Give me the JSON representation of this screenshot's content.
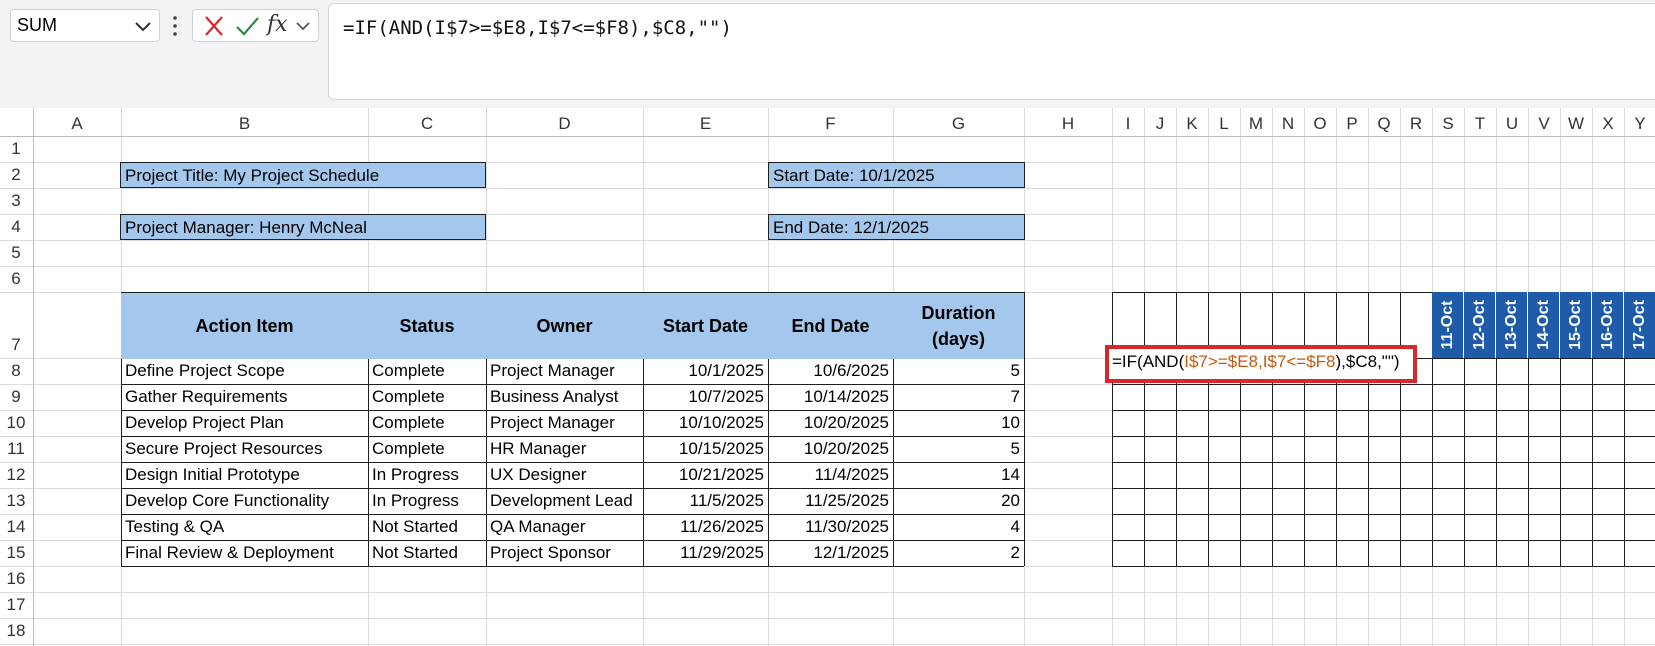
{
  "formula_bar": {
    "name_box": "SUM",
    "formula": "=IF(AND(I$7>=$E8,I$7<=$F8),$C8,\"\")",
    "icons": [
      "cancel-x-icon",
      "enter-check-icon",
      "insert-function-icon"
    ]
  },
  "columns": [
    "A",
    "B",
    "C",
    "D",
    "E",
    "F",
    "G",
    "H",
    "I",
    "J",
    "K",
    "L",
    "M",
    "N",
    "O",
    "P",
    "Q",
    "R",
    "S",
    "T",
    "U",
    "V",
    "W",
    "X",
    "Y"
  ],
  "rows": [
    "1",
    "2",
    "3",
    "4",
    "5",
    "6",
    "7",
    "8",
    "9",
    "10",
    "11",
    "12",
    "13",
    "14",
    "15",
    "16",
    "17",
    "18"
  ],
  "info": {
    "title": "Project Title: My Project Schedule",
    "manager": "Project Manager: Henry McNeal",
    "start": "Start Date: 10/1/2025",
    "end": "End Date: 12/1/2025"
  },
  "table": {
    "headers": [
      "Action Item",
      "Status",
      "Owner",
      "Start Date",
      "End Date",
      "Duration (days)"
    ],
    "rows": [
      [
        "Define Project Scope",
        "Complete",
        "Project Manager",
        "10/1/2025",
        "10/6/2025",
        "5"
      ],
      [
        "Gather Requirements",
        "Complete",
        "Business Analyst",
        "10/7/2025",
        "10/14/2025",
        "7"
      ],
      [
        "Develop Project Plan",
        "Complete",
        "Project Manager",
        "10/10/2025",
        "10/20/2025",
        "10"
      ],
      [
        "Secure Project Resources",
        "Complete",
        "HR Manager",
        "10/15/2025",
        "10/20/2025",
        "5"
      ],
      [
        "Design Initial Prototype",
        "In Progress",
        "UX Designer",
        "10/21/2025",
        "11/4/2025",
        "14"
      ],
      [
        "Develop Core Functionality",
        "In Progress",
        "Development Lead",
        "11/5/2025",
        "11/25/2025",
        "20"
      ],
      [
        "Testing & QA",
        "Not Started",
        "QA Manager",
        "11/26/2025",
        "11/30/2025",
        "4"
      ],
      [
        "Final Review & Deployment",
        "Not Started",
        "Project Sponsor",
        "11/29/2025",
        "12/1/2025",
        "2"
      ]
    ]
  },
  "date_headers": [
    "11-Oct",
    "12-Oct",
    "13-Oct",
    "14-Oct",
    "15-Oct",
    "16-Oct",
    "17-Oct"
  ],
  "edit_cell": {
    "p1": "=IF(AND(",
    "p2": "I$7>=$E8,I$7<=$F8",
    "p3": "),$C8,\"\")"
  },
  "colors": {
    "table_header": "#a4c8ed",
    "date_header": "#1e5ba8",
    "edit_highlight": "#d9262b"
  }
}
